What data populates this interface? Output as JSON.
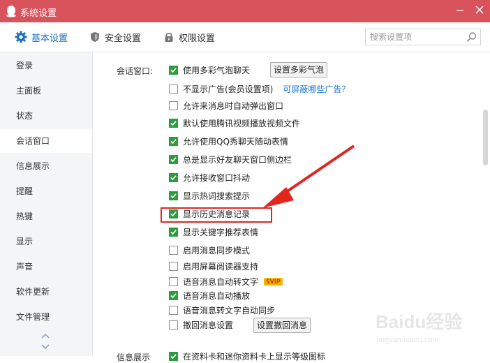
{
  "window": {
    "title": "系统设置",
    "minimize_icon": "minimize-icon",
    "close_icon": "close-icon"
  },
  "topnav": {
    "tabs": [
      {
        "label": "基本设置",
        "icon": "gear-icon",
        "active": true
      },
      {
        "label": "安全设置",
        "icon": "shield-icon",
        "active": false
      },
      {
        "label": "权限设置",
        "icon": "lock-icon",
        "active": false
      }
    ],
    "search": {
      "placeholder": "搜索设置项",
      "value": "",
      "icon": "search-icon"
    }
  },
  "sidebar": {
    "items": [
      {
        "label": "登录"
      },
      {
        "label": "主面板"
      },
      {
        "label": "状态"
      },
      {
        "label": "会话窗口",
        "active": true
      },
      {
        "label": "信息展示"
      },
      {
        "label": "提醒"
      },
      {
        "label": "热键"
      },
      {
        "label": "显示"
      },
      {
        "label": "声音"
      },
      {
        "label": "软件更新"
      },
      {
        "label": "文件管理"
      }
    ],
    "scroll_icons": [
      "chevron-up-icon",
      "chevron-down-icon"
    ]
  },
  "session": {
    "label": "会话窗口:",
    "options": [
      {
        "label": "使用多彩气泡聊天",
        "checked": true,
        "button": "设置多彩气泡"
      },
      {
        "label": "不显示广告(会员设置项)",
        "checked": false,
        "link": "可屏蔽哪些广告？"
      },
      {
        "label": "允许来消息时自动弹出窗口",
        "checked": false
      },
      {
        "label": "默认使用腾讯视频播放视频文件",
        "checked": true
      },
      {
        "label": "允许使用QQ秀聊天随动表情",
        "checked": true
      },
      {
        "label": "总是显示好友聊天窗口侧边栏",
        "checked": true
      },
      {
        "label": "允许接收窗口抖动",
        "checked": true
      },
      {
        "label": "显示热词搜索提示",
        "checked": true
      },
      {
        "label": "显示历史消息记录",
        "checked": true
      },
      {
        "label": "显示关键字推荐表情",
        "checked": true
      },
      {
        "label": "启用消息同步模式",
        "checked": false
      },
      {
        "label": "启用屏幕阅读器支持",
        "checked": false
      },
      {
        "label": "语音消息自动转文字",
        "checked": false,
        "badge": "SVIP"
      },
      {
        "label": "语音消息自动播放",
        "checked": true
      },
      {
        "label": "语音消息转文字自动同步",
        "checked": false
      },
      {
        "label": "撤回消息设置",
        "checked": false,
        "button": "设置撤回消息"
      }
    ]
  },
  "info_section": {
    "label": "信息展示",
    "first_option": "在资料卡和迷你资料卡上显示等级图标",
    "checked": true
  },
  "annotation": {
    "color": "#e0261e"
  },
  "watermark": {
    "text": "Baidu经验",
    "url": "jingyan.baidu.com"
  },
  "colors": {
    "titlebar": "#d9535d",
    "accent": "#1e6fbf",
    "check": "#2e9b3f"
  }
}
